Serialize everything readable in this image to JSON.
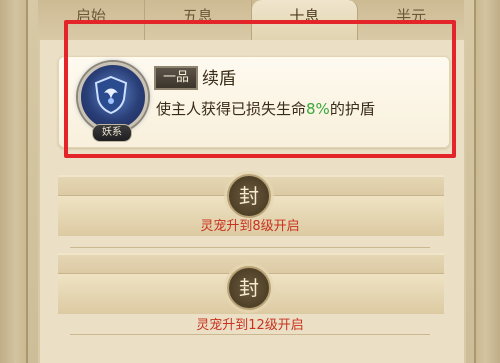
{
  "tabs": [
    {
      "label": "启始",
      "active": false
    },
    {
      "label": "五息",
      "active": false
    },
    {
      "label": "十息",
      "active": true
    },
    {
      "label": "半元",
      "active": false
    }
  ],
  "skill": {
    "grade": "一品",
    "name": "续盾",
    "type_badge": "妖系",
    "description_prefix": "使主人获得已损失生命",
    "description_value": "8%",
    "description_suffix": "的护盾",
    "icon": "shield-spirit-icon"
  },
  "locked_slots": [
    {
      "seal": "封",
      "unlock_text": "灵宠升到8级开启"
    },
    {
      "seal": "封",
      "unlock_text": "灵宠升到12级开启"
    }
  ],
  "colors": {
    "highlight": "#e3252a",
    "percent": "#3aa83d",
    "unlock_text": "#c8321e"
  }
}
